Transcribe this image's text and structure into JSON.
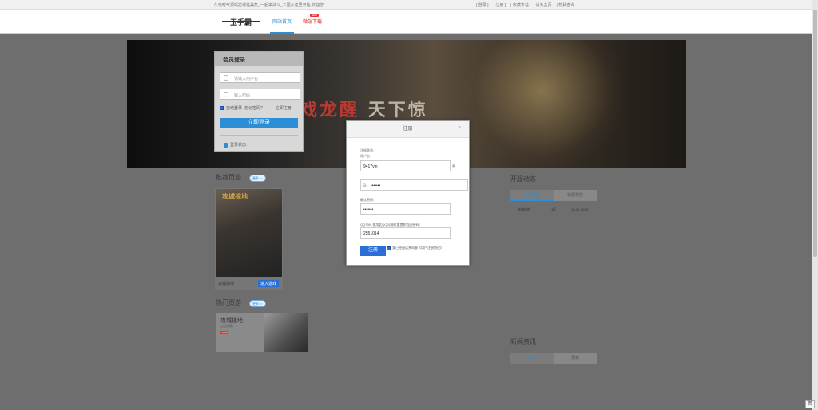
{
  "topbar": {
    "welcome": "久玩时气源吗拉城任美集_一起来战斗_三国从这里开始,欢迎您!",
    "links": [
      "[ 登录 ]",
      "[ 注册 ]",
      "| 收藏本站",
      "| 设为主页",
      "| 帮我查询"
    ]
  },
  "header": {
    "logo_text": "玉手霸",
    "logo_sub": "com",
    "nav": {
      "home": "网站首页",
      "download": "微端下载",
      "badge": "NEW"
    }
  },
  "banner": {
    "slogan_a": "戏龙醒",
    "slogan_b": "天下惊"
  },
  "login": {
    "title": "会员登录",
    "username_placeholder": "请输入用户名",
    "password_placeholder": "输入密码",
    "remember": "自动登录",
    "forgot": "忘记密码?",
    "register": "立即注册",
    "submit": "立即登录",
    "status": "登录状态:"
  },
  "recommend": {
    "title": "推荐页游",
    "more": "更多>>",
    "game_art_text": "攻城掠地",
    "game_name": "攻城掠地",
    "enter": "进入游戏"
  },
  "hot": {
    "title": "热门页游",
    "more": "更多>>",
    "game_name": "攻城掠地",
    "game_sub": "点击领取",
    "badge": "HOT"
  },
  "servers": {
    "title": "开服动态",
    "tabs": [
      "已开新服",
      "新服预告"
    ],
    "rows": [
      {
        "name": "攻城掠地",
        "server": "1区",
        "time": "10-20 10:00"
      }
    ]
  },
  "news": {
    "title": "新闻资讯",
    "tabs": [
      "公告",
      "更新"
    ]
  },
  "modal": {
    "title": "注册",
    "close": "×",
    "hint": "注册状态:",
    "username_label": "用户名:",
    "username_value": "9417yin",
    "side_char": "或",
    "password_label": "码:",
    "password_value": "•••••••",
    "confirm_label": "确认密码:",
    "confirm_value": "•••••••",
    "qq_label": "QQ号码,使用此QQ可随时重置和找回密码!",
    "qq_value": "2551014",
    "submit": "注册",
    "agree": "我已经阅读并同意《用户注册协议》"
  },
  "ime": "英"
}
